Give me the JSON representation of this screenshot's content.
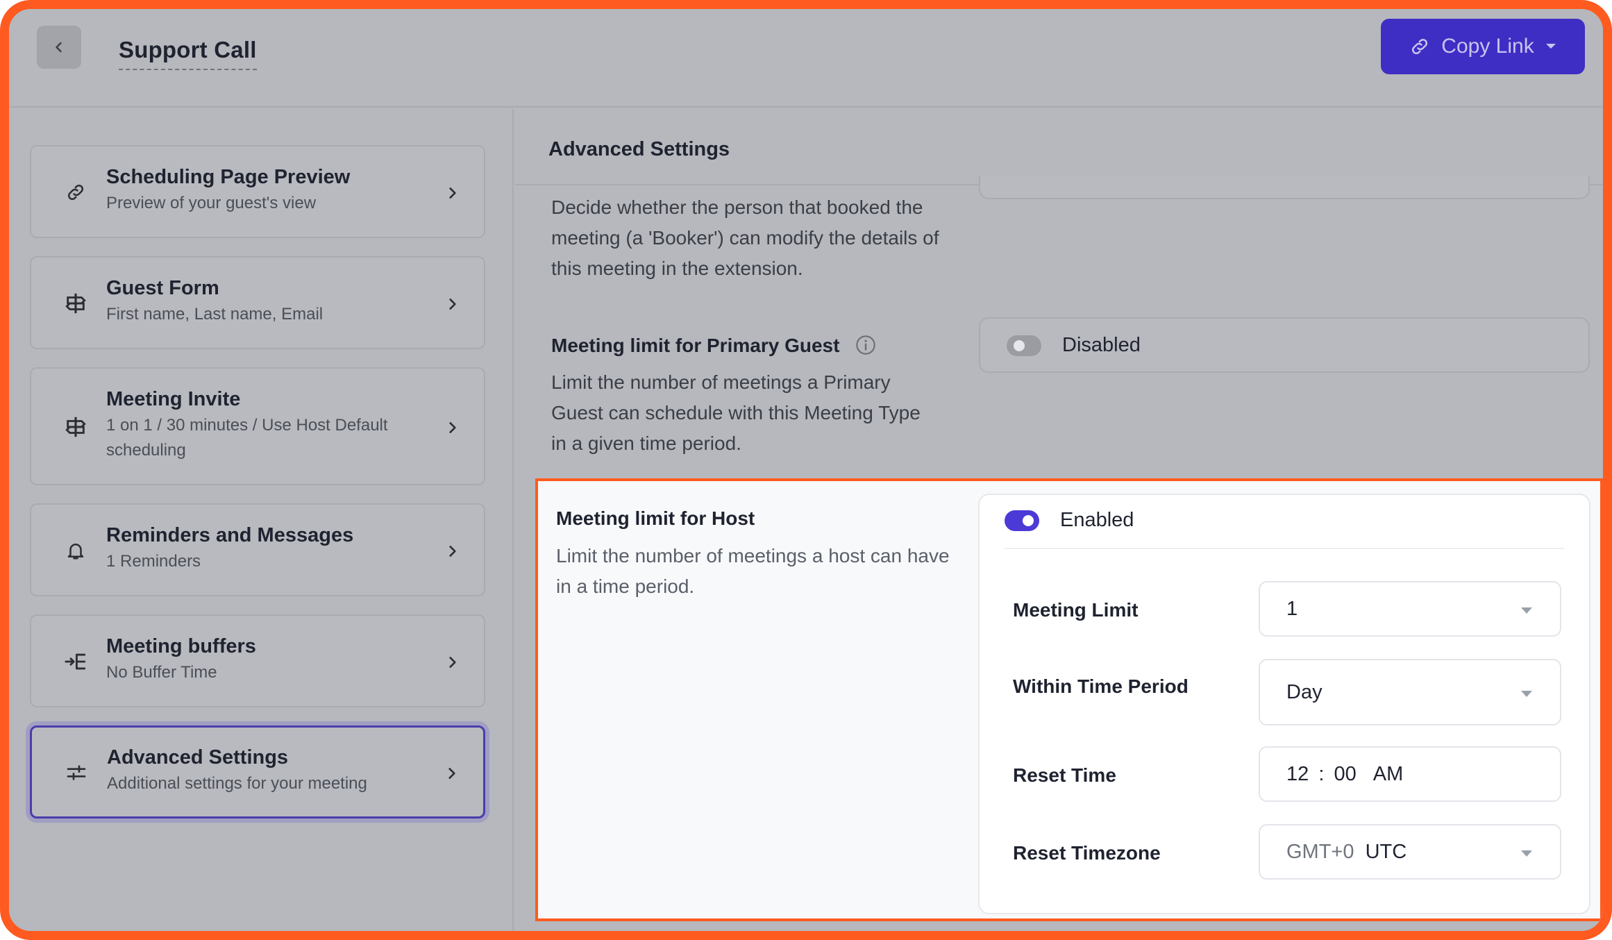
{
  "header": {
    "title": "Support Call",
    "copy_link_label": "Copy Link"
  },
  "sidebar": {
    "items": [
      {
        "title": "Scheduling Page Preview",
        "subtitle": "Preview of your guest's view"
      },
      {
        "title": "Guest Form",
        "subtitle": "First name, Last name, Email"
      },
      {
        "title": "Meeting Invite",
        "subtitle": "1 on 1 / 30 minutes / Use Host Default scheduling"
      },
      {
        "title": "Reminders and Messages",
        "subtitle": "1 Reminders"
      },
      {
        "title": "Meeting buffers",
        "subtitle": "No Buffer Time"
      },
      {
        "title": "Advanced Settings",
        "subtitle": "Additional settings for your meeting"
      }
    ]
  },
  "main": {
    "title": "Advanced Settings",
    "booker": {
      "description": "Decide whether the person that booked the meeting (a 'Booker') can modify the details of this meeting in the extension."
    },
    "primary_guest_limit": {
      "title": "Meeting limit for Primary Guest",
      "description": "Limit the number of meetings a Primary Guest can schedule with this Meeting Type in a given time period.",
      "status": "Disabled"
    },
    "host_limit": {
      "title": "Meeting limit for Host",
      "description": "Limit the number of meetings a host can have in a time period.",
      "status": "Enabled",
      "fields": {
        "meeting_limit_label": "Meeting Limit",
        "meeting_limit_value": "1",
        "period_label": "Within Time Period",
        "period_value": "Day",
        "reset_time_label": "Reset Time",
        "reset_hour": "12",
        "reset_sep": ":",
        "reset_minute": "00",
        "reset_ampm": "AM",
        "reset_tz_label": "Reset Timezone",
        "reset_tz_offset": "GMT+0",
        "reset_tz_name": "UTC"
      }
    }
  },
  "colors": {
    "accent": "#3f2ec4",
    "toggle_on": "#4b3ad6",
    "highlight_border": "#ff5a1f"
  }
}
